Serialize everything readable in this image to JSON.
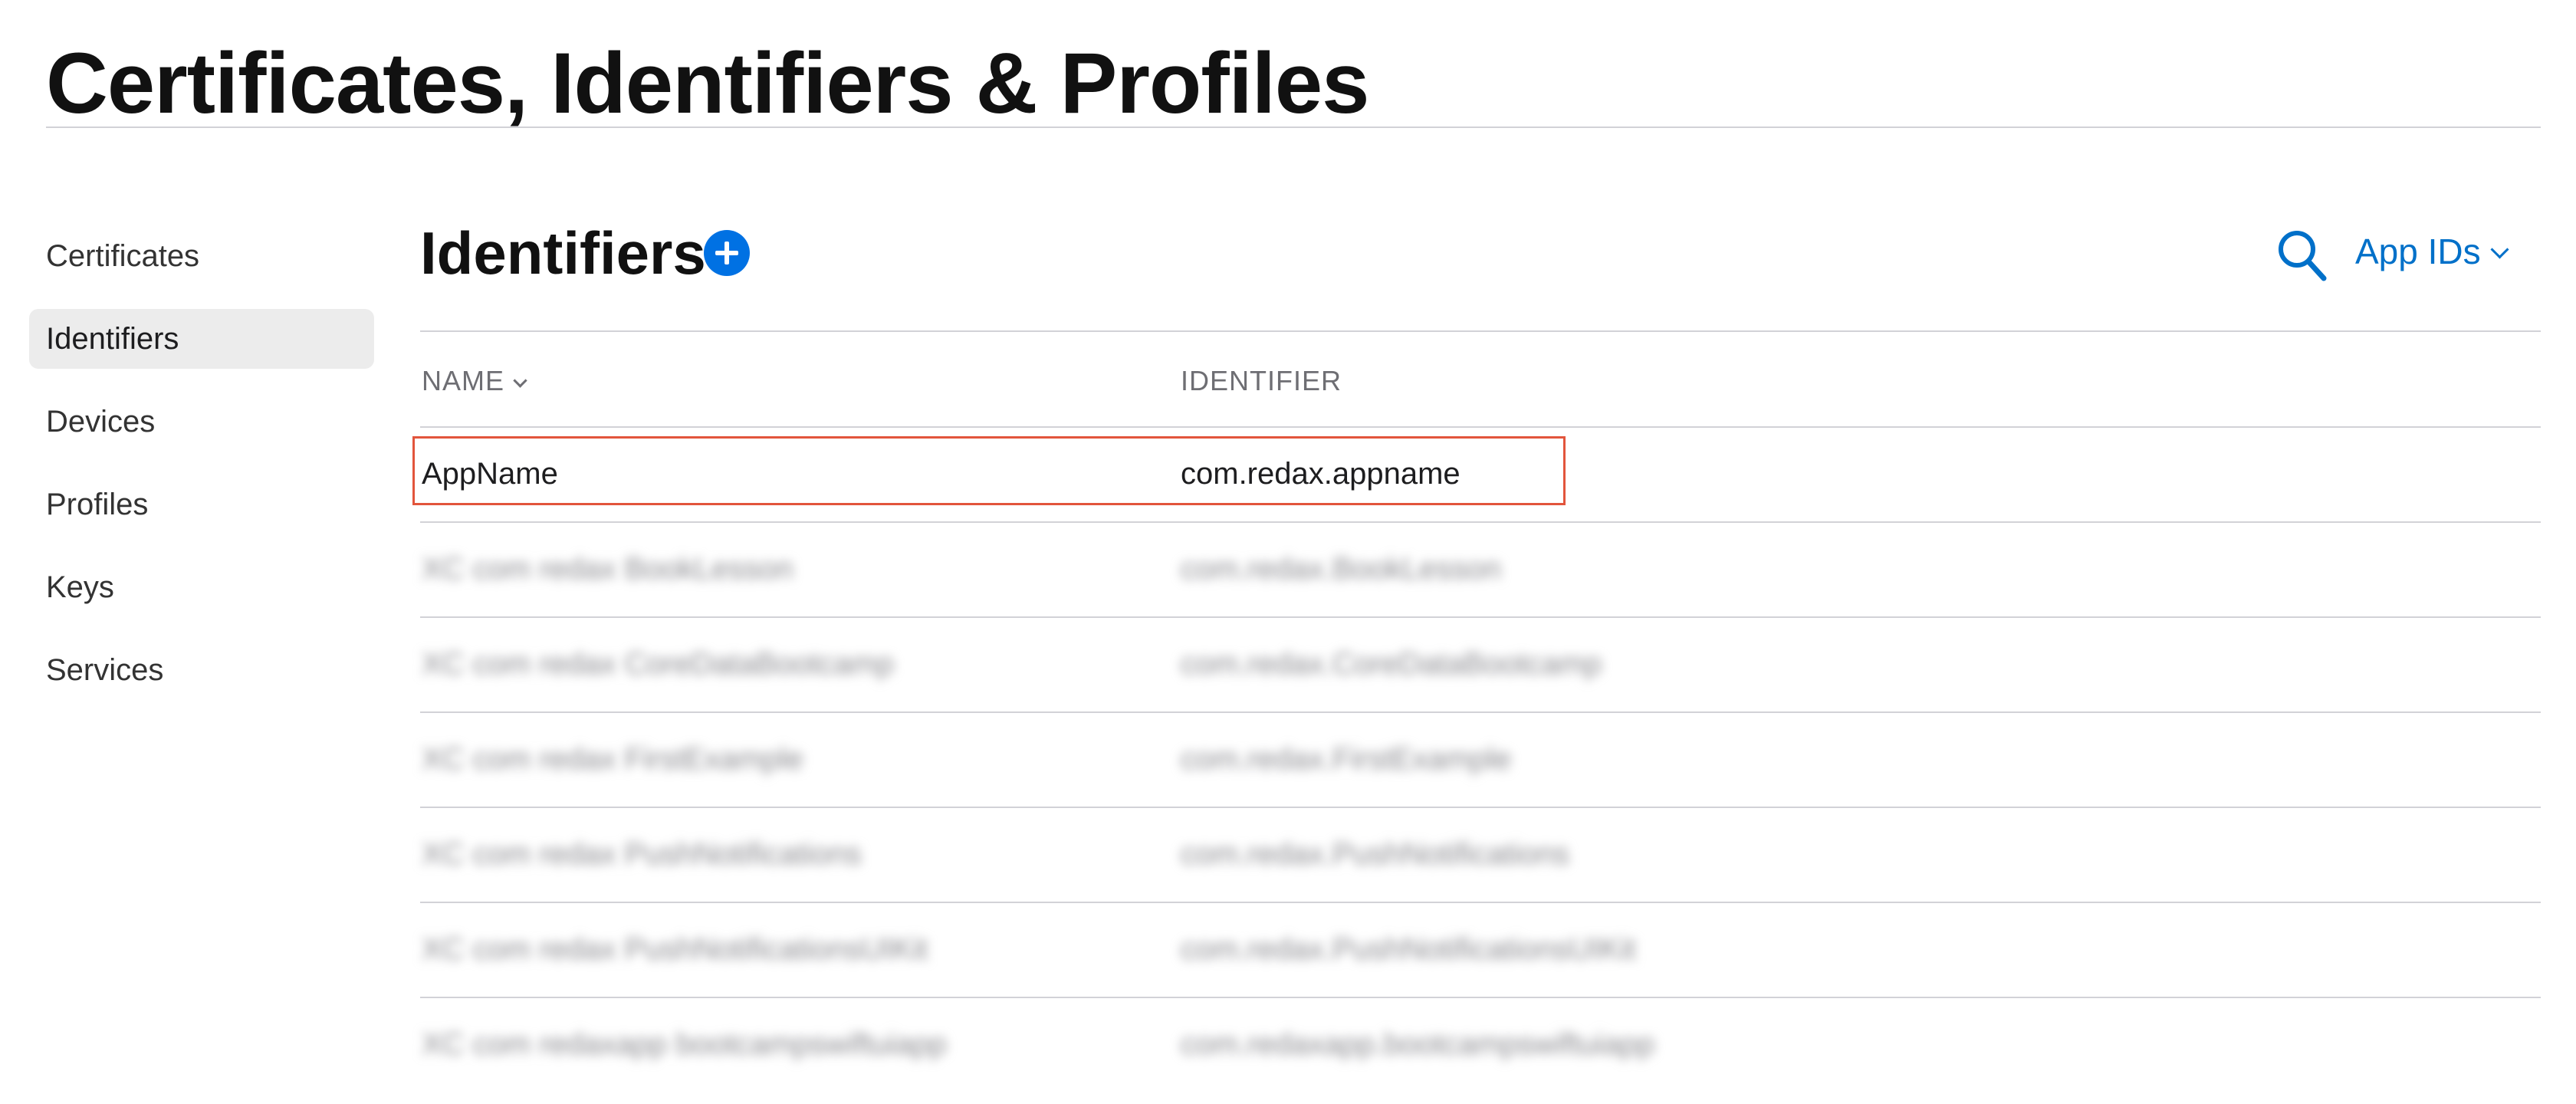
{
  "page": {
    "title": "Certificates, Identifiers & Profiles"
  },
  "sidebar": {
    "items": [
      {
        "label": "Certificates",
        "active": false
      },
      {
        "label": "Identifiers",
        "active": true
      },
      {
        "label": "Devices",
        "active": false
      },
      {
        "label": "Profiles",
        "active": false
      },
      {
        "label": "Keys",
        "active": false
      },
      {
        "label": "Services",
        "active": false
      }
    ]
  },
  "main": {
    "section_title": "Identifiers",
    "add_icon": "plus-circle-icon",
    "search_icon": "search-icon",
    "filter_label": "App IDs",
    "accent_color": "#0071e3",
    "columns": {
      "name": "NAME",
      "identifier": "IDENTIFIER"
    },
    "rows": [
      {
        "name": "AppName",
        "identifier": "com.redax.appname",
        "blurred": false
      },
      {
        "name": "XC com redax BookLesson",
        "identifier": "com.redax.BookLesson",
        "blurred": true
      },
      {
        "name": "XC com redax CoreDataBootcamp",
        "identifier": "com.redax.CoreDataBootcamp",
        "blurred": true
      },
      {
        "name": "XC com redax FirstExample",
        "identifier": "com.redax.FirstExample",
        "blurred": true
      },
      {
        "name": "XC com redax PushNotifications",
        "identifier": "com.redax.PushNotifications",
        "blurred": true
      },
      {
        "name": "XC com redax PushNotificationsUIKit",
        "identifier": "com.redax.PushNotificationsUIKit",
        "blurred": true
      },
      {
        "name": "XC com redaxapp bootcampswiftuiapp",
        "identifier": "com.redaxapp.bootcampswiftuiapp",
        "blurred": true
      }
    ],
    "highlight_color": "#e2553c"
  }
}
